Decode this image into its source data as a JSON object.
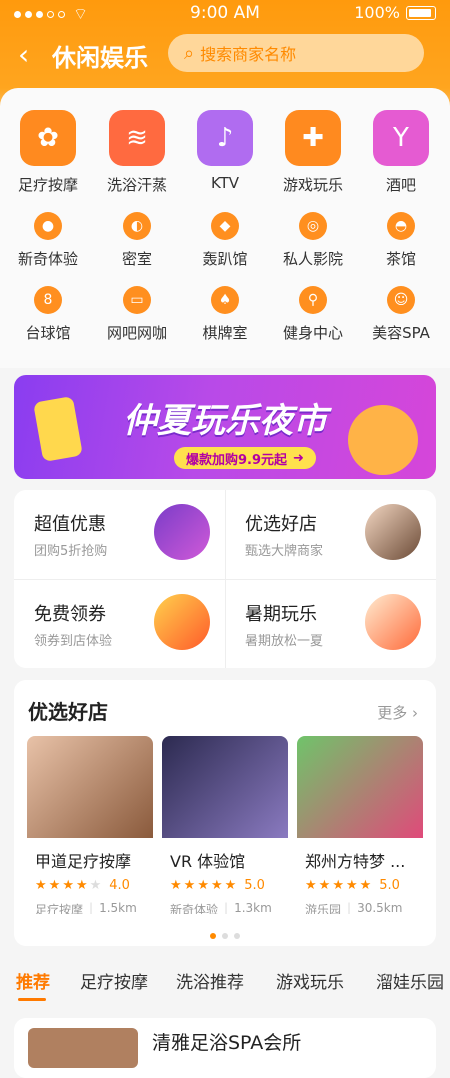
{
  "status": {
    "time": "9:00 AM",
    "battery": "100%"
  },
  "nav": {
    "back_icon": "chevron-left-icon",
    "title": "休闲娱乐",
    "search_placeholder": "搜索商家名称"
  },
  "big_categories": [
    {
      "label": "足疗按摩",
      "icon": "foot-icon",
      "color": "#ff8a1f"
    },
    {
      "label": "洗浴汗蒸",
      "icon": "bath-icon",
      "color": "#ff6a40"
    },
    {
      "label": "KTV",
      "icon": "microphone-icon",
      "color": "#b06cf0"
    },
    {
      "label": "游戏玩乐",
      "icon": "gamepad-icon",
      "color": "#ff8a1f"
    },
    {
      "label": "酒吧",
      "icon": "wine-glass-icon",
      "color": "#e55bd2"
    }
  ],
  "small_categories_row1": [
    {
      "label": "新奇体验",
      "icon": "novelty-icon"
    },
    {
      "label": "密室",
      "icon": "mask-icon"
    },
    {
      "label": "轰趴馆",
      "icon": "party-icon"
    },
    {
      "label": "私人影院",
      "icon": "film-reel-icon"
    },
    {
      "label": "茶馆",
      "icon": "teapot-icon"
    }
  ],
  "small_categories_row2": [
    {
      "label": "台球馆",
      "icon": "billiard-ball-icon"
    },
    {
      "label": "网吧网咖",
      "icon": "monitor-icon"
    },
    {
      "label": "棋牌室",
      "icon": "cards-icon"
    },
    {
      "label": "健身中心",
      "icon": "cycling-icon"
    },
    {
      "label": "美容SPA",
      "icon": "face-mask-icon"
    }
  ],
  "banner": {
    "title": "仲夏玩乐夜市",
    "subtitle": "爆款加购9.9元起"
  },
  "promo": [
    {
      "title": "超值优惠",
      "sub": "团购5折抢购"
    },
    {
      "title": "优选好店",
      "sub": "甄选大牌商家"
    },
    {
      "title": "免费领券",
      "sub": "领券到店体验"
    },
    {
      "title": "暑期玩乐",
      "sub": "暑期放松一夏"
    }
  ],
  "shops": {
    "heading": "优选好店",
    "more": "更多",
    "items": [
      {
        "name": "甲道足疗按摩",
        "rating": "4.0",
        "stars": 4,
        "category": "足疗按摩",
        "distance": "1.5km",
        "color": "#c98b6a"
      },
      {
        "name": "VR 体验馆",
        "rating": "5.0",
        "stars": 5,
        "category": "新奇体验",
        "distance": "1.3km",
        "color": "#5a4a8a"
      },
      {
        "name": "郑州方特梦 ...",
        "rating": "5.0",
        "stars": 5,
        "category": "游乐园",
        "distance": "30.5km",
        "color": "#6aa86a"
      }
    ]
  },
  "tabs": [
    "推荐",
    "足疗按摩",
    "洗浴推荐",
    "游戏玩乐",
    "溜娃乐园"
  ],
  "bottom_card": {
    "title": "清雅足浴SPA会所"
  }
}
